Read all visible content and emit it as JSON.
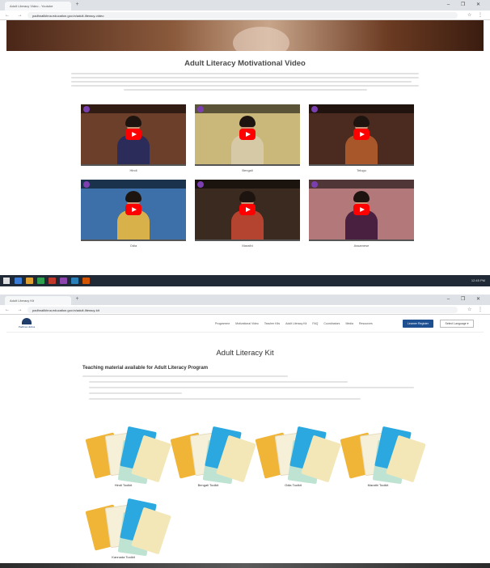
{
  "shot1": {
    "browser": {
      "tab_title": "Adult Literacy Video - Youtube",
      "new_tab": "+",
      "window_controls": "– ❐ ✕",
      "nav": "← → ⟳",
      "url": "padhnalikhna.education.gov.in/adult-literacy-video",
      "ext": "☆ ⋮"
    },
    "page": {
      "title": "Adult Literacy Motivational Video"
    },
    "videos": [
      {
        "label": "Hindi",
        "bg": "#6b3f2a",
        "body": "#2c2c5a"
      },
      {
        "label": "Bengali",
        "bg": "#c9b87a",
        "body": "#d6c9a6"
      },
      {
        "label": "Telugu",
        "bg": "#4b2a20",
        "body": "#a8572a"
      },
      {
        "label": "Odia",
        "bg": "#3d6fa8",
        "body": "#d9b14a"
      },
      {
        "label": "Marathi",
        "bg": "#3a2a20",
        "body": "#b4432f"
      },
      {
        "label": "Assamese",
        "bg": "#b3787a",
        "body": "#4a2040"
      }
    ],
    "taskbar": {
      "clock": "12:45 PM"
    }
  },
  "shot2": {
    "browser": {
      "tab_title": "Adult Literacy Kit",
      "new_tab": "+",
      "window_controls": "– ❐ ✕",
      "nav": "← → ⟳",
      "url": "padhnalikhna.education.gov.in/adult-literacy-kit",
      "ext": "☆ ⋮"
    },
    "nav": {
      "logo_text": "Padhna Likhna",
      "menu": [
        "Programme",
        "Motivational Video",
        "Teacher Kits",
        "Adult Literacy Kit",
        "FAQ",
        "Coordinators",
        "Media",
        "Resources"
      ],
      "login_label": "Learner Register",
      "language_label": "Select Language ▾"
    },
    "page": {
      "title": "Adult Literacy Kit",
      "subtitle": "Teaching material available for Adult Literacy Program"
    },
    "kits": [
      {
        "label": "Hindi Toolkit"
      },
      {
        "label": "Bengali Toolkit"
      },
      {
        "label": "Odia Toolkit"
      },
      {
        "label": "Marathi Toolkit"
      },
      {
        "label": "Kannada Toolkit"
      }
    ]
  }
}
